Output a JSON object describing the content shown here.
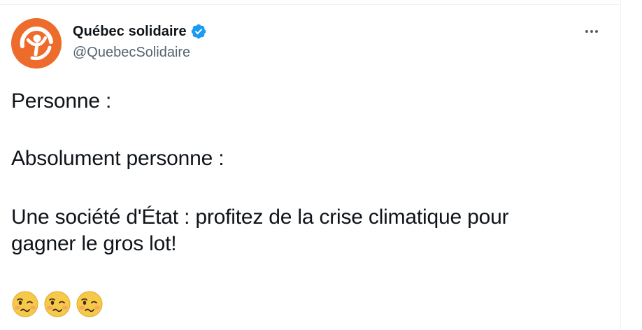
{
  "account": {
    "display_name": "Québec solidaire",
    "handle": "@QuebecSolidaire",
    "verified": true,
    "avatar_color": "#ee6c2b"
  },
  "tweet": {
    "line1": "Personne :",
    "line2": "Absolument personne :",
    "line3": "Une société d'État : profitez de la crise climatique pour\ngagner le gros lot!",
    "emojis": [
      "woozy-face",
      "woozy-face",
      "woozy-face"
    ]
  },
  "icons": {
    "more": "more-horizontal-icon",
    "verified": "verified-badge-icon"
  },
  "colors": {
    "verified_blue": "#1d9bf0",
    "text_primary": "#0f1419",
    "text_secondary": "#536471"
  }
}
